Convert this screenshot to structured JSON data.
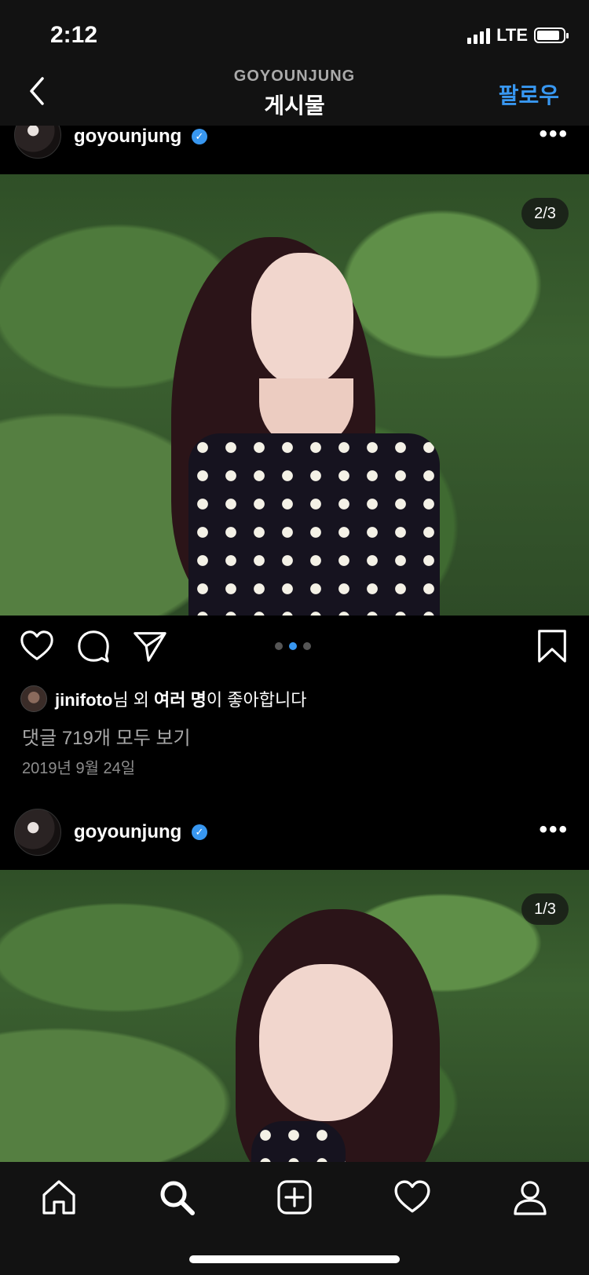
{
  "status_bar": {
    "time": "2:12",
    "network": "LTE"
  },
  "header": {
    "subtitle": "GOYOUNJUNG",
    "title": "게시물",
    "follow_label": "팔로우"
  },
  "posts": [
    {
      "username": "goyounjung",
      "verified": true,
      "image_counter": "2/3",
      "carousel": {
        "count": 3,
        "active_index": 1
      },
      "likes": {
        "user": "jinifoto",
        "suffix_1": "님 외 ",
        "others": "여러 명",
        "suffix_2": "이 좋아합니다"
      },
      "comments_link": "댓글 719개 모두 보기",
      "date": "2019년 9월 24일"
    },
    {
      "username": "goyounjung",
      "verified": true,
      "image_counter": "1/3"
    }
  ],
  "icons": {
    "back": "chevron-left-icon",
    "more": "more-horizontal-icon",
    "like": "heart-icon",
    "comment": "comment-icon",
    "share": "paper-plane-icon",
    "save": "bookmark-icon"
  },
  "bottom_nav": {
    "items": [
      "home-icon",
      "search-icon",
      "add-post-icon",
      "activity-heart-icon",
      "profile-icon"
    ],
    "active": "search-icon"
  },
  "colors": {
    "accent": "#3897f0",
    "background": "#000000",
    "bar": "#121212"
  }
}
